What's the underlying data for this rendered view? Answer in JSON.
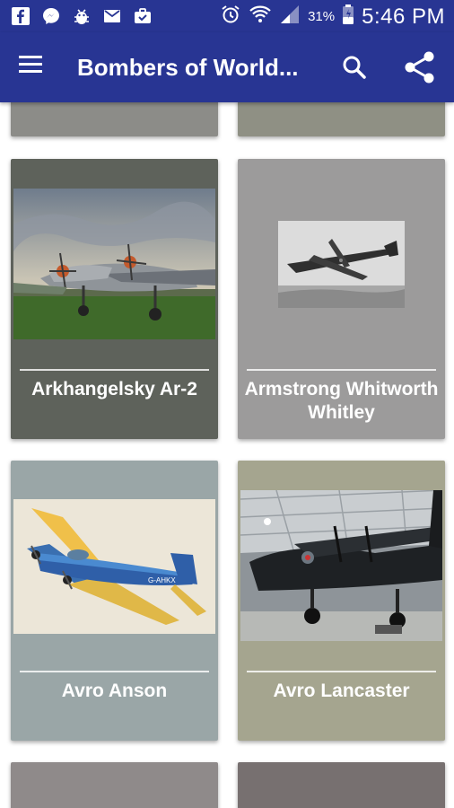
{
  "status_bar": {
    "battery_percent": "31%",
    "time": "5:46 PM",
    "icons": [
      "facebook-icon",
      "messenger-icon",
      "android-debug-icon",
      "mail-icon",
      "briefcase-icon",
      "alarm-icon",
      "wifi-icon",
      "signal-icon",
      "battery-icon"
    ]
  },
  "app_bar": {
    "title": "Bombers of World...",
    "icons": [
      "menu-icon",
      "search-icon",
      "share-icon"
    ]
  },
  "cards": [
    {
      "label": "Arkhangelsky Ar-2"
    },
    {
      "label": "Armstrong Whitworth Whitley"
    },
    {
      "label": "Avro Anson"
    },
    {
      "label": "Avro Lancaster"
    }
  ],
  "colors": {
    "primary": "#283593",
    "card_1": "#5e625b",
    "card_2": "#9c9b9b",
    "card_3": "#9aa6a7",
    "card_4": "#a5a58f"
  }
}
